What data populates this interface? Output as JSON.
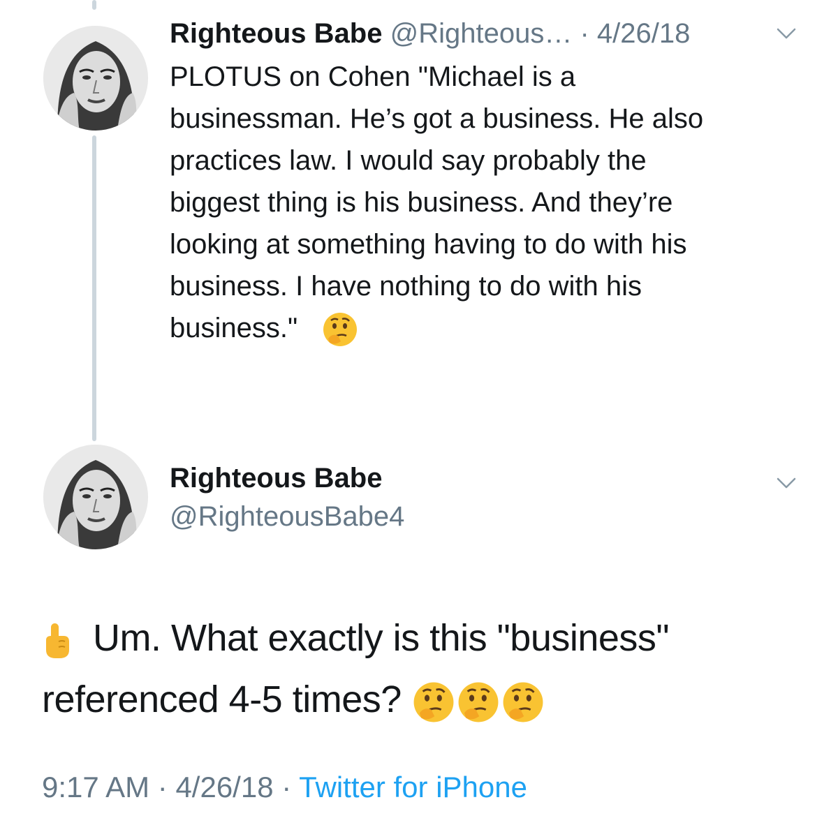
{
  "parent_tweet": {
    "display_name": "Righteous Babe",
    "handle_truncated": "@Righteous…",
    "separator": " · ",
    "date": "4/26/18",
    "body_lines": [
      "PLOTUS on Cohen \"Michael is a",
      "businessman. He’s got a business. He also",
      "practices law. I would say probably the",
      "biggest thing is his business. And they’re",
      "looking at something having to do with his",
      "business. I have nothing to do with his",
      "business.\""
    ],
    "trailing_emoji": "thinking-face"
  },
  "main_tweet": {
    "display_name": "Righteous Babe",
    "handle": "@RighteousBabe4",
    "body_line_1": "Um. What exactly is this \"business\"",
    "body_line_2": "referenced 4-5 times?",
    "leading_emoji": "backhand-index-pointing-up",
    "trailing_emojis": [
      "thinking-face",
      "thinking-face",
      "thinking-face"
    ],
    "time": "9:17 AM",
    "separator": " · ",
    "date": "4/26/18",
    "source": "Twitter for iPhone"
  },
  "colors": {
    "text": "#14171a",
    "muted": "#657786",
    "link": "#1da1f2",
    "thread_line": "#ccd6dd"
  }
}
